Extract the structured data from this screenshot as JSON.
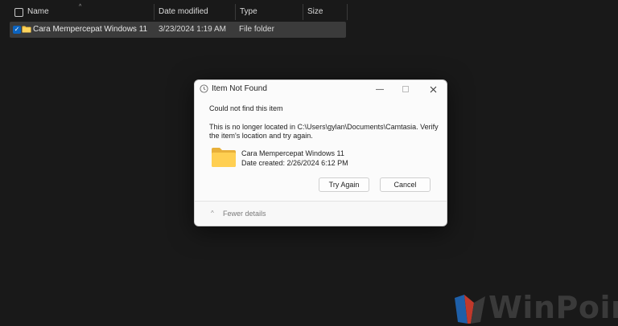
{
  "explorer": {
    "columns": {
      "name": "Name",
      "date_modified": "Date modified",
      "type": "Type",
      "size": "Size"
    },
    "row": {
      "name": "Cara Mempercepat Windows 11",
      "date_modified": "3/23/2024 1:19 AM",
      "type": "File folder",
      "selected": true
    }
  },
  "dialog": {
    "title": "Item Not Found",
    "heading": "Could not find this item",
    "message": "This is no longer located in C:\\Users\\gylan\\Documents\\Camtasia. Verify the item's location and try again.",
    "item_name": "Cara Mempercepat Windows 11",
    "item_date": "Date created: 2/26/2024 6:12 PM",
    "try_again_label": "Try Again",
    "cancel_label": "Cancel",
    "fewer_details_label": "Fewer details"
  },
  "watermark": {
    "text": "WinPoin"
  },
  "colors": {
    "background": "#191919",
    "selection": "#3b3b3b",
    "checkbox_accent": "#0c64c0",
    "folder_yellow": "#f5c443",
    "dialog_bg": "#fbfbfb"
  }
}
